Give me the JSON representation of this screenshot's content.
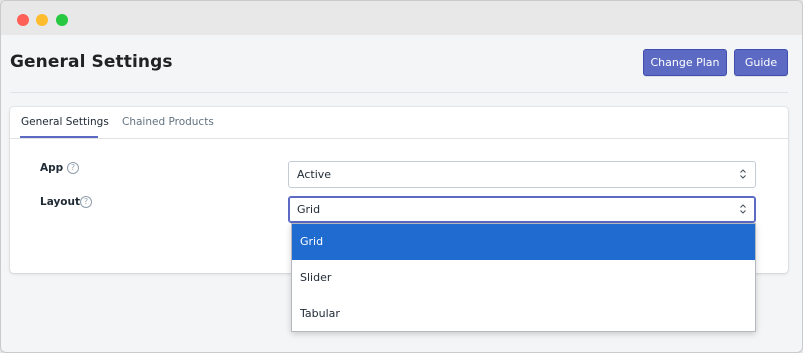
{
  "window": {
    "controls": [
      "close",
      "minimize",
      "maximize"
    ]
  },
  "header": {
    "title": "General Settings",
    "change_plan_label": "Change Plan",
    "guide_label": "Guide"
  },
  "tabs": [
    {
      "label": "General Settings",
      "active": true
    },
    {
      "label": "Chained Products",
      "active": false
    }
  ],
  "fields": {
    "app": {
      "label": "App",
      "value": "Active",
      "help_icon": "question-circle-icon"
    },
    "layout": {
      "label": "Layout",
      "value": "Grid",
      "help_icon": "question-circle-icon"
    }
  },
  "layout_dropdown": {
    "options": [
      "Grid",
      "Slider",
      "Tabular"
    ],
    "selected": "Grid"
  },
  "colors": {
    "primary_button": "#5c6ac4",
    "selected_option": "#1f6bcf",
    "tab_underline": "#5c6ac4"
  }
}
